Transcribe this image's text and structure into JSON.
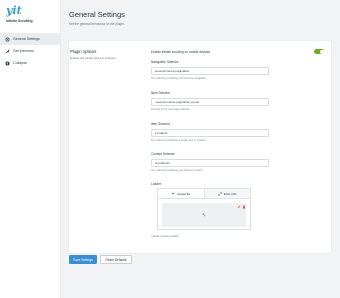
{
  "sidebar": {
    "logo_text": "yit",
    "plugin_name": "Infinite Scrolling",
    "items": [
      {
        "label": "General Settings",
        "icon": "gear-icon",
        "active": true
      },
      {
        "label": "Get premium",
        "icon": "rocket-icon",
        "active": false
      },
      {
        "label": "Collapse",
        "icon": "collapse-icon",
        "active": false
      }
    ]
  },
  "header": {
    "title": "General Settings",
    "subtitle": "Set the general behaviour of the plugin."
  },
  "plugin_options": {
    "title": "Plugin options",
    "description": "Enable the plugin and set sections.",
    "enable_label": "Enable infinite scrolling on mobile devices",
    "enable_on": true,
    "fields": [
      {
        "label": "Navigation Selector",
        "value": "woocommerce-pagination",
        "help": "The selector containing your theme's navigation."
      },
      {
        "label": "Next Selector",
        "value": ".woocommerce-pagination a.next",
        "help": "The link to the next page selector."
      },
      {
        "label": "Item Selector",
        "value": "li.product",
        "help": "The selector containing a single post or product."
      },
      {
        "label": "Content Selector",
        "value": "ul.products",
        "help": "The selector containing your theme's content."
      }
    ],
    "loader": {
      "label": "Loader",
      "tabs": [
        {
          "label": "Upload file",
          "icon": "upload-icon"
        },
        {
          "label": "Enter URL",
          "icon": "link-icon"
        }
      ],
      "preview_icon": "spinner-icon",
      "help": "Upload a custom loader."
    }
  },
  "footer": {
    "save_label": "Save Settings",
    "reset_label": "Reset Defaults"
  },
  "colors": {
    "accent": "#3a8fd4",
    "toggle_on": "#6fa829",
    "logo": "#3aa0c8"
  }
}
